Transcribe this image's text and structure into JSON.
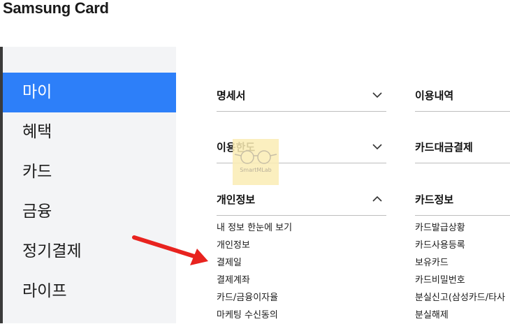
{
  "brand": {
    "logo_text": "Samsung Card"
  },
  "sidebar": {
    "items": [
      {
        "label": "마이",
        "active": true
      },
      {
        "label": "혜택"
      },
      {
        "label": "카드"
      },
      {
        "label": "금융"
      },
      {
        "label": "정기결제"
      },
      {
        "label": "라이프"
      }
    ]
  },
  "menu_left": {
    "statement": {
      "title": "명세서",
      "chevron": "chevron-down-icon"
    },
    "limit": {
      "title": "이용한도",
      "chevron": "chevron-down-icon"
    },
    "personal": {
      "title": "개인정보",
      "chevron": "chevron-up-icon",
      "items": [
        "내 정보 한눈에 보기",
        "개인정보",
        "결제일",
        "결제계좌",
        "카드/금융이자율",
        "마케팅 수신동의"
      ]
    }
  },
  "menu_right": {
    "history": {
      "title": "이용내역"
    },
    "payment": {
      "title": "카드대금결제"
    },
    "card_info": {
      "title": "카드정보",
      "items": [
        "카드발급상황",
        "카드사용등록",
        "보유카드",
        "카드비밀번호",
        "분실신고(삼성카드/타사",
        "분실해제"
      ]
    }
  },
  "watermark": {
    "text": "SmartMLab"
  },
  "colors": {
    "accent": "#2d7ff9",
    "arrow": "#e8231f",
    "sidebar_bg": "#f3f4f6"
  }
}
